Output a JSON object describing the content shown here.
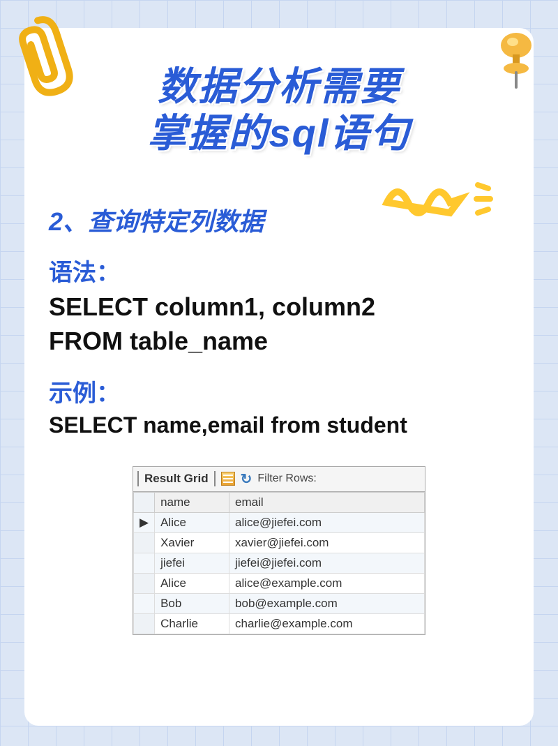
{
  "title_line1": "数据分析需要",
  "title_line2": "掌握的sql语句",
  "section": "2、查询特定列数据",
  "syntax_label": "语法：",
  "syntax_code1": "SELECT column1, column2",
  "syntax_code2": "FROM table_name",
  "example_label": "示例：",
  "example_code": "SELECT name,email from  student",
  "grid": {
    "toolbar_title": "Result Grid",
    "filter_label": "Filter Rows:",
    "columns": [
      "name",
      "email"
    ],
    "rows": [
      {
        "name": "Alice",
        "email": "alice@jiefei.com",
        "current": true
      },
      {
        "name": "Xavier",
        "email": "xavier@jiefei.com"
      },
      {
        "name": "jiefei",
        "email": "jiefei@jiefei.com"
      },
      {
        "name": "Alice",
        "email": "alice@example.com"
      },
      {
        "name": "Bob",
        "email": "bob@example.com"
      },
      {
        "name": "Charlie",
        "email": "charlie@example.com"
      }
    ]
  }
}
